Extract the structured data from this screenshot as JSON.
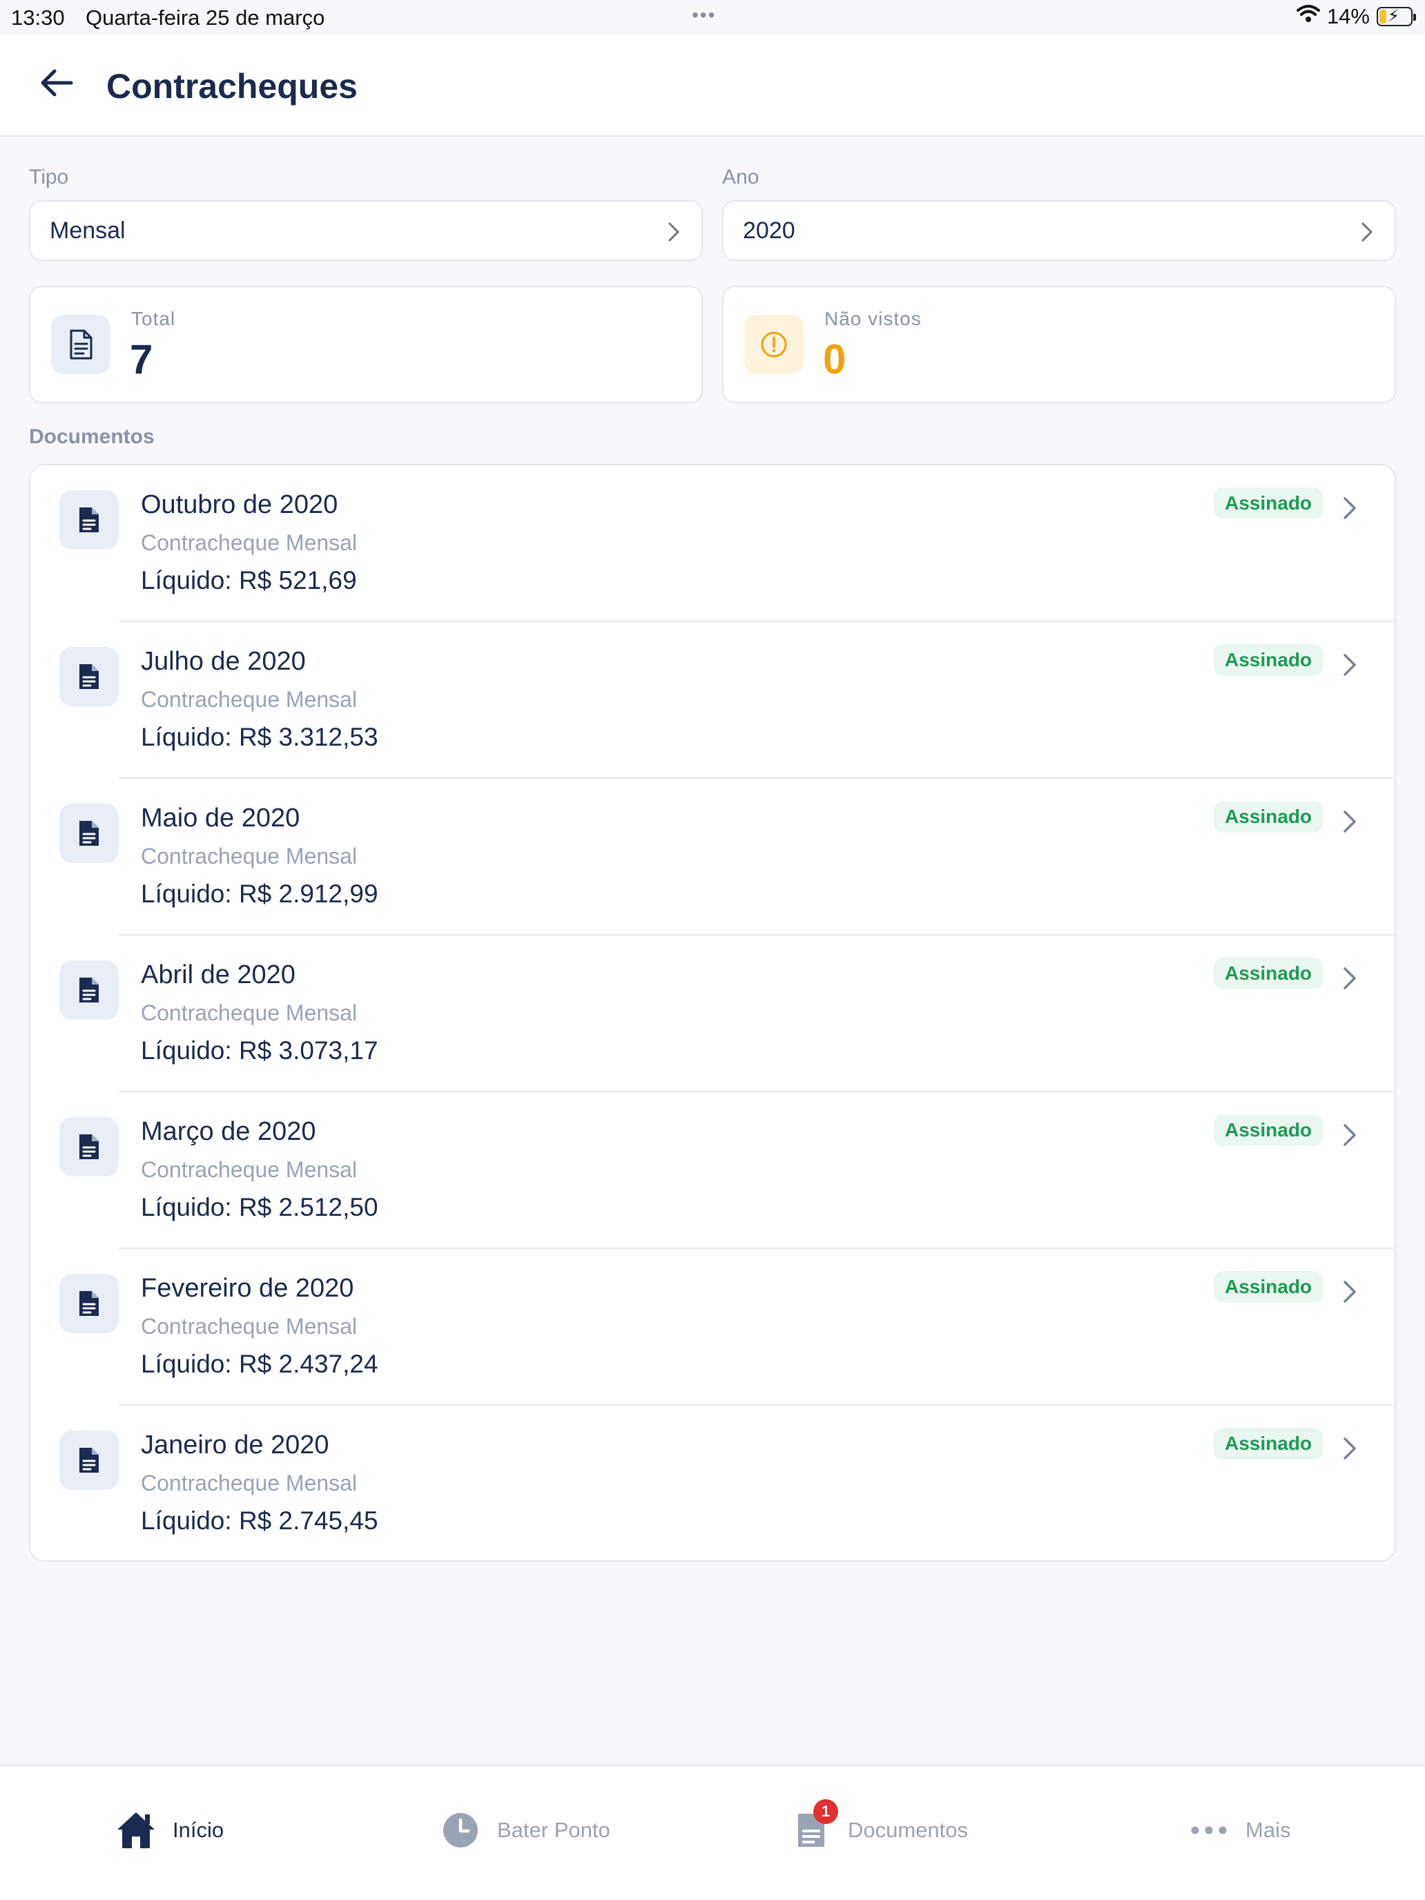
{
  "status_bar": {
    "time": "13:30",
    "date": "Quarta-feira 25 de março",
    "dots": "•••",
    "battery": "14%"
  },
  "header": {
    "title": "Contracheques"
  },
  "filters": {
    "tipo_label": "Tipo",
    "tipo_value": "Mensal",
    "ano_label": "Ano",
    "ano_value": "2020"
  },
  "summary": {
    "total_label": "Total",
    "total_value": "7",
    "nao_vistos_label": "Não vistos",
    "nao_vistos_value": "0"
  },
  "section_label": "Documentos",
  "documents": [
    {
      "title": "Outubro de 2020",
      "subtitle": "Contracheque Mensal",
      "amount": "Líquido: R$ 521,69",
      "status": "Assinado"
    },
    {
      "title": "Julho de 2020",
      "subtitle": "Contracheque Mensal",
      "amount": "Líquido: R$ 3.312,53",
      "status": "Assinado"
    },
    {
      "title": "Maio de 2020",
      "subtitle": "Contracheque Mensal",
      "amount": "Líquido: R$ 2.912,99",
      "status": "Assinado"
    },
    {
      "title": "Abril de 2020",
      "subtitle": "Contracheque Mensal",
      "amount": "Líquido: R$ 3.073,17",
      "status": "Assinado"
    },
    {
      "title": "Março de 2020",
      "subtitle": "Contracheque Mensal",
      "amount": "Líquido: R$ 2.512,50",
      "status": "Assinado"
    },
    {
      "title": "Fevereiro de 2020",
      "subtitle": "Contracheque Mensal",
      "amount": "Líquido: R$ 2.437,24",
      "status": "Assinado"
    },
    {
      "title": "Janeiro de 2020",
      "subtitle": "Contracheque Mensal",
      "amount": "Líquido: R$ 2.745,45",
      "status": "Assinado"
    }
  ],
  "bottom_nav": {
    "inicio": "Início",
    "bater_ponto": "Bater Ponto",
    "documentos": "Documentos",
    "documentos_badge": "1",
    "mais": "Mais"
  },
  "colors": {
    "primary": "#1b2a4e",
    "muted": "#8a93a5",
    "warning": "#f0a20c",
    "success": "#1f9a55",
    "badge": "#e0302f"
  }
}
